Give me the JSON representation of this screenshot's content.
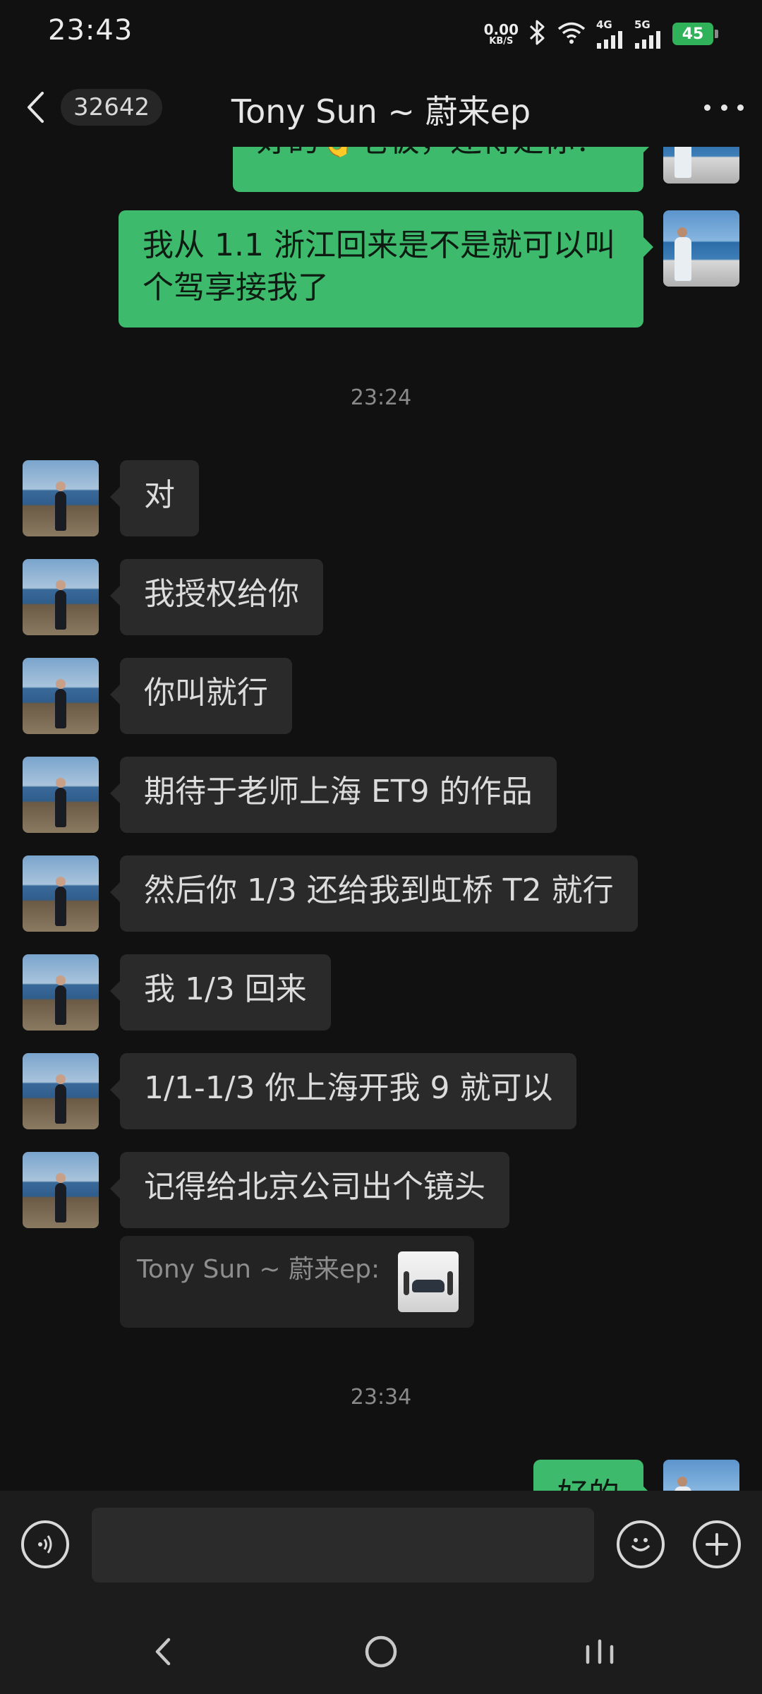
{
  "status_bar": {
    "time": "23:43",
    "net_speed_value": "0.00",
    "net_speed_unit": "KB/S",
    "signal1_label": "4G",
    "signal2_label": "5G",
    "battery": "45",
    "icons": [
      "bluetooth-icon",
      "wifi-icon",
      "signal-4g-icon",
      "signal-5g-icon",
      "battery-charging-icon"
    ]
  },
  "header": {
    "unread_count": "32642",
    "title": "Tony Sun ~ 蔚来ep",
    "icons": [
      "back-chevron-icon",
      "more-icon"
    ]
  },
  "messages": [
    {
      "side": "out",
      "text": "好的👌老板，还得是你！"
    },
    {
      "side": "out",
      "text": "我从 1.1 浙江回来是不是就可以叫个驾享接我了"
    },
    {
      "side": "in",
      "text": "对"
    },
    {
      "side": "in",
      "text": "我授权给你"
    },
    {
      "side": "in",
      "text": "你叫就行"
    },
    {
      "side": "in",
      "text": "期待于老师上海 ET9 的作品"
    },
    {
      "side": "in",
      "text": "然后你 1/3 还给我到虹桥 T2 就行"
    },
    {
      "side": "in",
      "text": "我 1/3 回来"
    },
    {
      "side": "in",
      "text": "1/1-1/3 你上海开我 9 就可以"
    },
    {
      "side": "in",
      "text": "记得给北京公司出个镜头"
    },
    {
      "side": "out",
      "text": "好的"
    }
  ],
  "timestamps": [
    "23:24",
    "23:34"
  ],
  "quote": {
    "sender": "Tony Sun ~ 蔚来ep:",
    "thumbnail": "group-photo-with-car"
  },
  "input_bar": {
    "placeholder": "",
    "icons": [
      "voice-icon",
      "emoji-icon",
      "plus-icon"
    ]
  },
  "nav_bar": {
    "icons": [
      "nav-back-icon",
      "nav-home-icon",
      "nav-recents-icon"
    ]
  },
  "colors": {
    "background": "#111111",
    "incoming_bubble": "#2a2a2a",
    "outgoing_bubble": "#3dba6b",
    "battery": "#30b25a"
  }
}
